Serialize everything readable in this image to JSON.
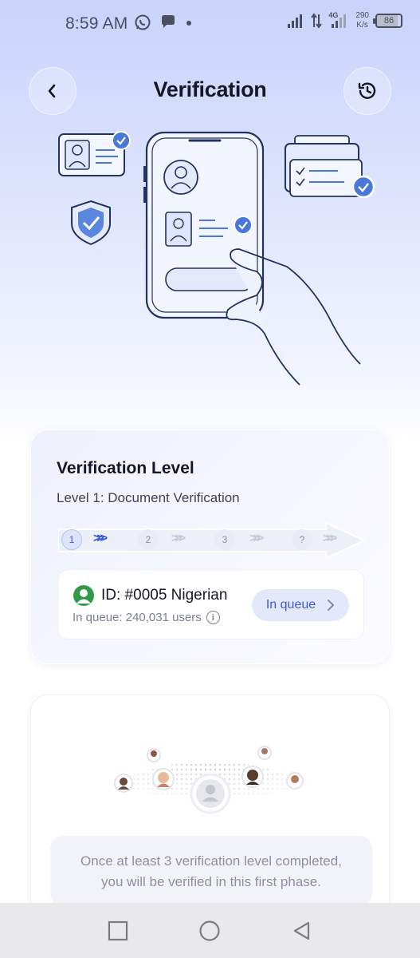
{
  "status_bar": {
    "time": "8:59 AM",
    "network_type": "4G",
    "speed_value": "290",
    "speed_unit": "K/s",
    "battery": "86"
  },
  "header": {
    "title": "Verification",
    "back_icon": "chevron-left-icon",
    "history_icon": "history-clock-icon"
  },
  "level_card": {
    "title": "Verification Level",
    "subtitle": "Level 1: Document Verification",
    "steps": [
      {
        "label": "1",
        "active": true
      },
      {
        "label": "2",
        "active": false
      },
      {
        "label": "3",
        "active": false
      },
      {
        "label": "?",
        "active": false
      }
    ],
    "id_label": "ID: #0005 Nigerian",
    "queue_text": "In queue: 240,031 users",
    "queue_button": "In queue"
  },
  "phase_card": {
    "note_line1": "Once at least 3 verification level completed,",
    "note_line2": "you will be verified in this first phase."
  },
  "colors": {
    "accent": "#3a5bd9",
    "check_blue": "#3d6fd8",
    "avatar_green": "#2e9a4a"
  }
}
